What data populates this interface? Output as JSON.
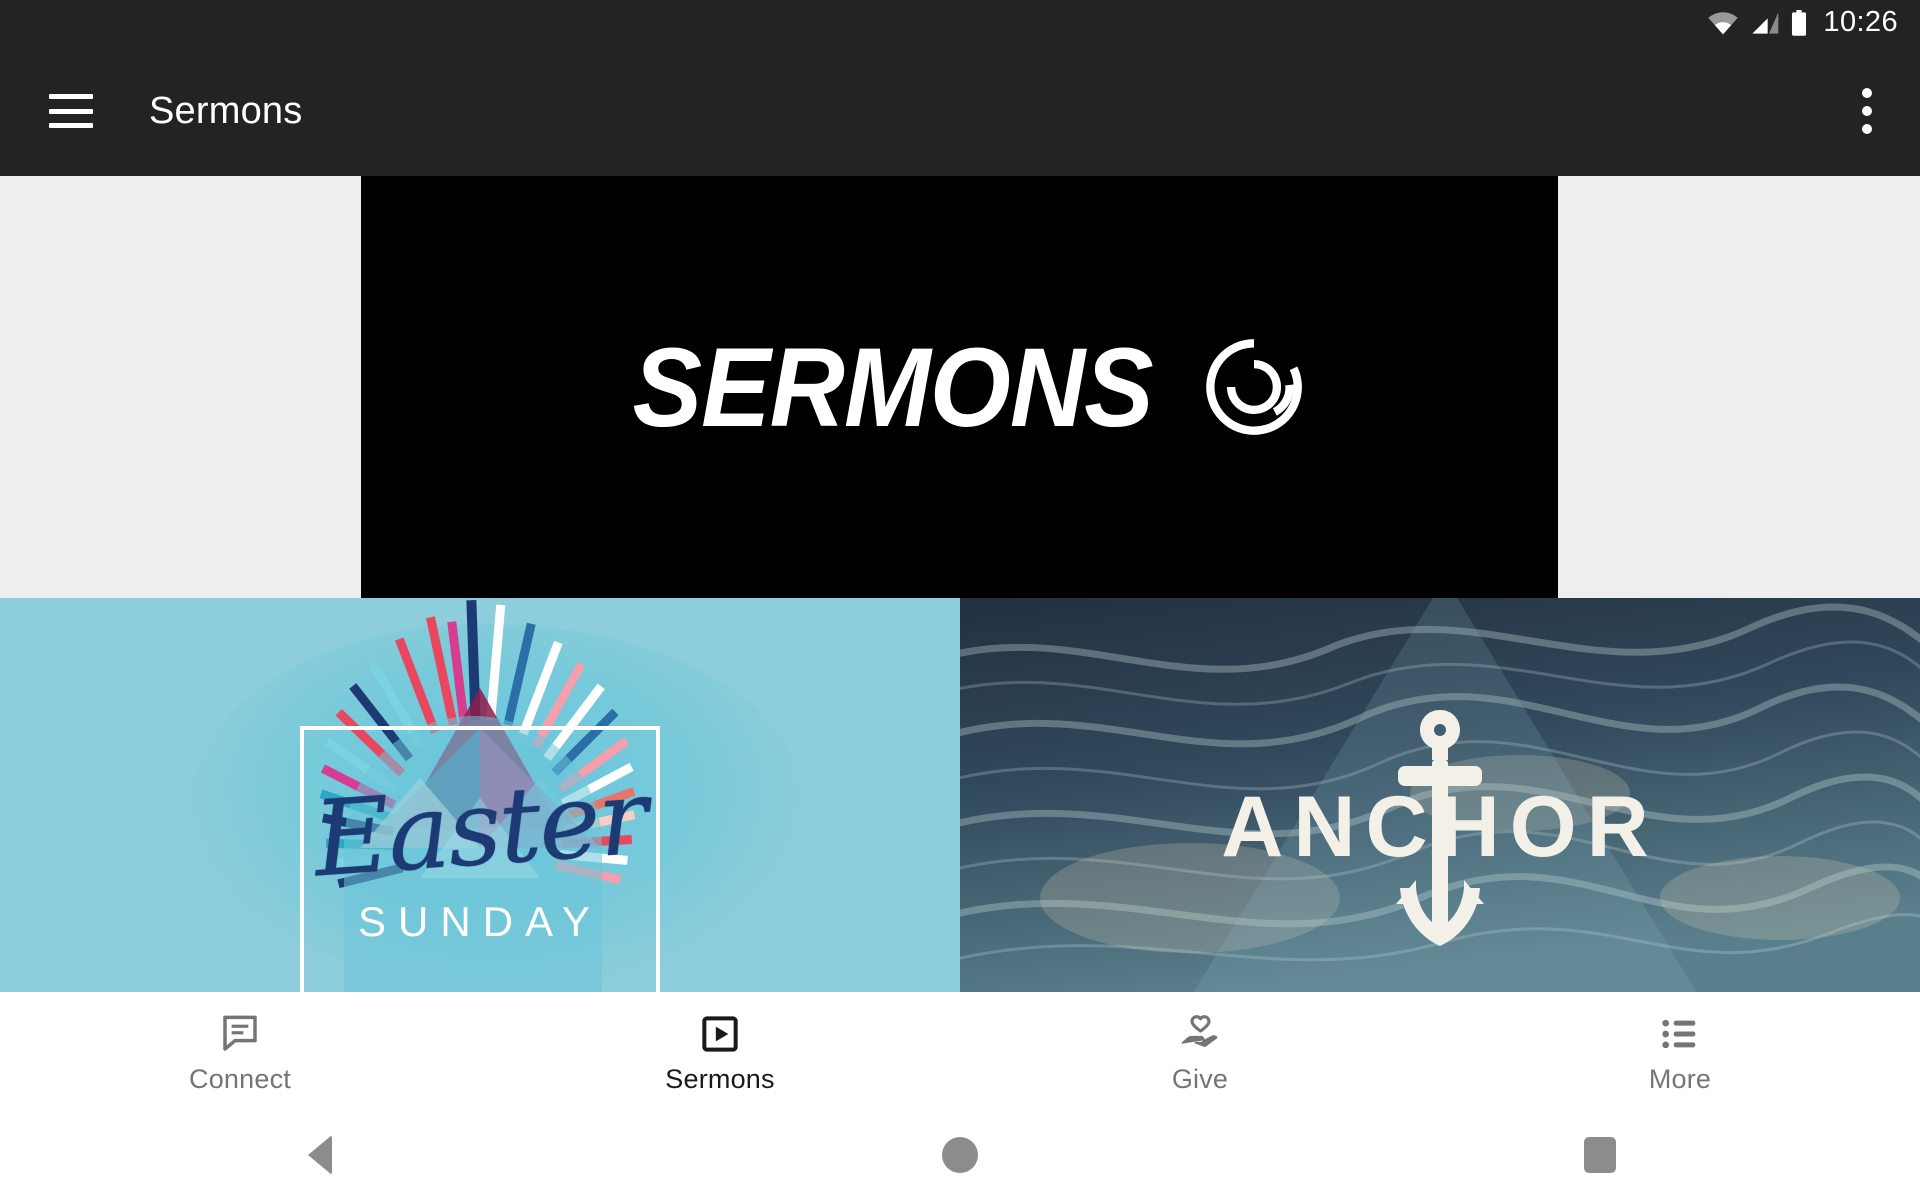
{
  "status_bar": {
    "time": "10:26",
    "icons": [
      "wifi-icon",
      "cellular-signal-icon",
      "battery-icon"
    ]
  },
  "app_bar": {
    "menu_icon": "hamburger-menu-icon",
    "title": "Sermons",
    "overflow_icon": "overflow-menu-icon"
  },
  "content": {
    "background_color": "#eceef0",
    "hero": {
      "word": "SERMONS",
      "logo_icon": "circular-spiral-logo-icon",
      "background_color": "#000000",
      "text_color": "#ffffff"
    },
    "tiles": [
      {
        "name": "easter-sunday",
        "title_script": "Easter",
        "subtitle": "SUNDAY",
        "background_color": "#8ecddb",
        "script_color": "#1c3a74",
        "subtitle_color": "#ffffff"
      },
      {
        "name": "anchor",
        "title": "ANCHOR",
        "background_color": "#2b3d4e",
        "title_color": "#f3f0e8",
        "icon": "anchor-icon"
      }
    ]
  },
  "bottom_nav": {
    "items": [
      {
        "label": "Connect",
        "icon": "chat-bubble-icon",
        "active": false
      },
      {
        "label": "Sermons",
        "icon": "video-play-icon",
        "active": true
      },
      {
        "label": "Give",
        "icon": "hand-heart-icon",
        "active": false
      },
      {
        "label": "More",
        "icon": "list-icon",
        "active": false
      }
    ],
    "active_color": "#1a1a1a",
    "inactive_color": "#757575"
  },
  "system_nav": {
    "buttons": [
      "back-button",
      "home-button",
      "recents-button"
    ],
    "color": "#8c8c8c"
  }
}
